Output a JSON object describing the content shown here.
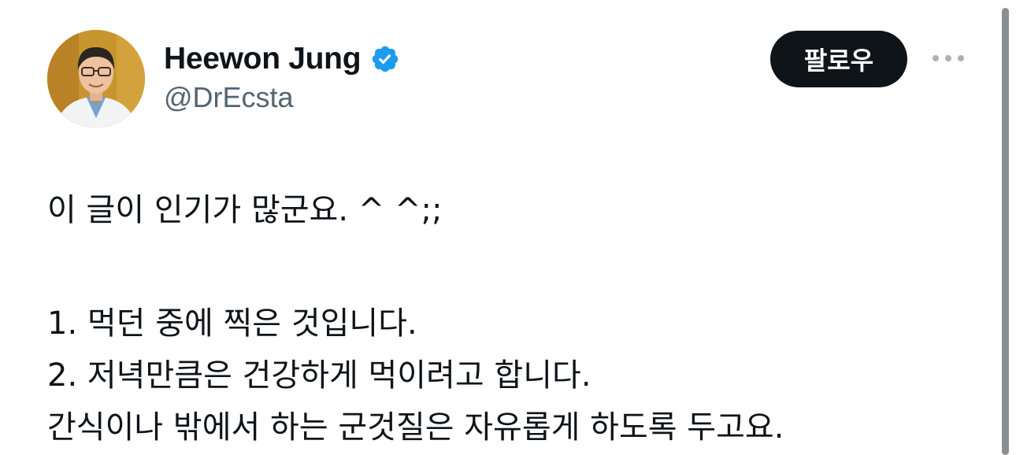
{
  "author": {
    "display_name": "Heewon Jung",
    "handle": "@DrEcsta",
    "verified_icon": "verified-badge-icon",
    "avatar": "profile-photo"
  },
  "actions": {
    "follow_label": "팔로우",
    "more_icon": "more-options-icon"
  },
  "tweet": {
    "lines": [
      "이 글이 인기가 많군요. ^ ^;;",
      "",
      "1. 먹던 중에 찍은 것입니다.",
      "2. 저녁만큼은 건강하게 먹이려고 합니다.",
      "간식이나 밖에서 하는 군것질은 자유롭게 하도록 두고요."
    ]
  },
  "colors": {
    "text_primary": "#0f1419",
    "text_secondary": "#536471",
    "verified_blue": "#1d9bf0",
    "follow_bg": "#0f1419"
  }
}
